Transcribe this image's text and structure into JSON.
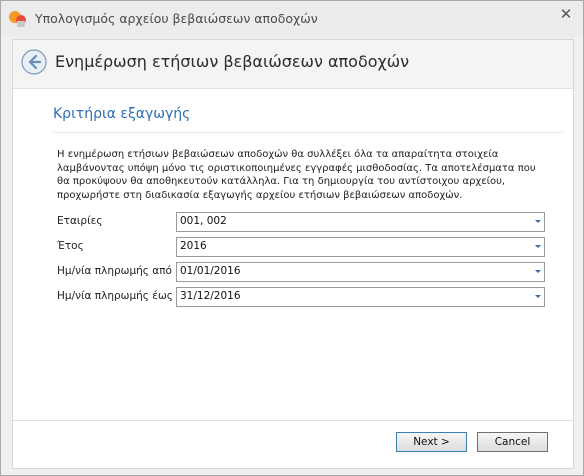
{
  "window": {
    "title": "Υπολογισμός αρχείου βεβαιώσεων αποδοχών",
    "close_label": "✕"
  },
  "header": {
    "title": "Ενημέρωση ετήσιων βεβαιώσεων αποδοχών"
  },
  "section": {
    "title": "Κριτήρια εξαγωγής",
    "description": "Η ενημέρωση ετήσιων βεβαιώσεων αποδοχών θα συλλέξει όλα τα απαραίτητα στοιχεία\nλαμβάνοντας υπόψη μόνο τις οριστικοποιημένες εγγραφές μισθοδοσίας. Τα αποτελέσματα που\nθα προκύψουν θα αποθηκευτούν κατάλληλα. Για τη δημιουργία του αντίστοιχου αρχείου,\nπροχωρήστε στη διαδικασία εξαγωγής αρχείου ετήσιων βεβαιώσεων αποδοχών."
  },
  "fields": [
    {
      "label": "Εταιρίες",
      "value": "001, 002"
    },
    {
      "label": "Έτος",
      "value": "2016"
    },
    {
      "label": "Ημ/νία πληρωμής από",
      "value": "01/01/2016"
    },
    {
      "label": "Ημ/νία πληρωμής έως",
      "value": "31/12/2016"
    }
  ],
  "buttons": {
    "next": "Next >",
    "cancel": "Cancel"
  }
}
